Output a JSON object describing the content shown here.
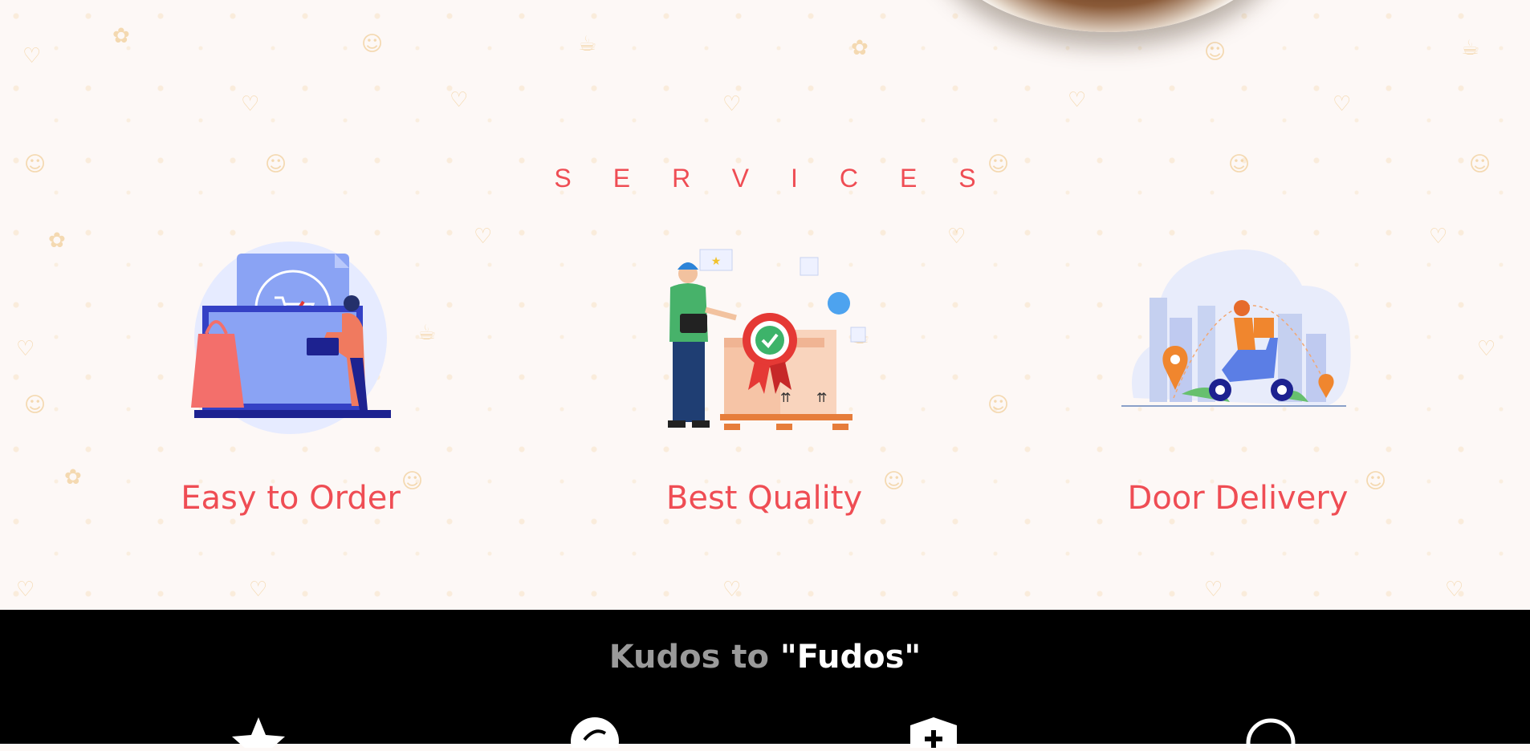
{
  "services": {
    "heading": "SERVICES",
    "items": [
      {
        "label": "Easy to Order",
        "icon": "online-cart-order-icon"
      },
      {
        "label": "Best Quality",
        "icon": "quality-badge-icon"
      },
      {
        "label": "Door Delivery",
        "icon": "scooter-delivery-icon"
      }
    ]
  },
  "footer": {
    "kudos_prefix": "Kudos to ",
    "kudos_brand": "\"Fudos\"",
    "icons": [
      "star-icon",
      "chat-icon",
      "shield-icon",
      "search-icon"
    ]
  },
  "colors": {
    "accent": "#ef4d54",
    "pattern": "#f2cf9a",
    "background": "#fdf8f6",
    "footer_bg": "#000000",
    "kudos_grey": "#9a9a9a"
  }
}
